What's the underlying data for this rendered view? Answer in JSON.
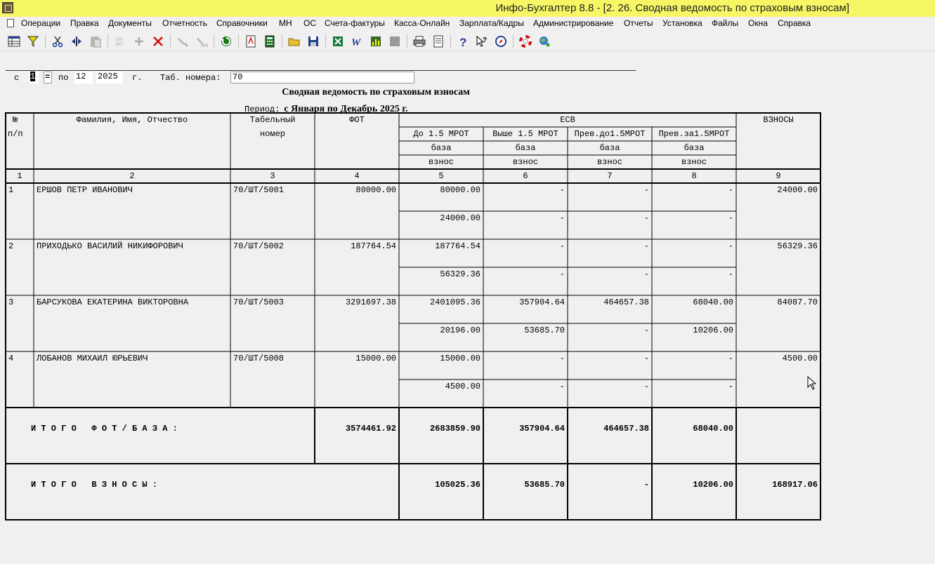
{
  "window": {
    "title": "Инфо-Бухгалтер 8.8 - [2. 26. Сводная ведомость по страховым взносам]"
  },
  "menu": [
    "Операции",
    "Правка",
    "Документы",
    "Отчетность",
    "Справочники",
    "МН",
    "ОС",
    "Счета-фактуры",
    "Касса-Онлайн",
    "Зарплата/Кадры",
    "Администрирование",
    "Отчеты",
    "Установка",
    "Файлы",
    "Окна",
    "Справка"
  ],
  "toolbar_icons": [
    "table-icon",
    "filter-icon",
    "cut-icon",
    "split-icon",
    "paste-icon",
    "rotate-icon",
    "add-icon",
    "delete-icon",
    "marker-icon",
    "marker2-icon",
    "refresh-icon",
    "pdf-icon",
    "calculator-icon",
    "open-folder-icon",
    "save-icon",
    "excel-icon",
    "word-icon",
    "chart-icon",
    "gray-icon",
    "print-icon",
    "preview-icon",
    "help-icon",
    "context-help-icon",
    "compass-icon",
    "lifebuoy-icon",
    "globe-icon"
  ],
  "params": {
    "from_label": "с",
    "from_value": "1",
    "to_label": "по",
    "to_value": "12",
    "year_value": "2025",
    "year_label": "г.",
    "tab_label": "Таб. номера:",
    "tab_value": "70"
  },
  "report": {
    "title": "Сводная ведомость по страховым взносам",
    "period_label": "Период:",
    "period_value": "с Января по Декабрь 2025 г.",
    "headers": {
      "num1": "№",
      "num2": "п/п",
      "fio": "Фамилия, Имя, Отчество",
      "tab1": "Табельный",
      "tab2": "номер",
      "fot": "ФОТ",
      "esv": "ЕСВ",
      "sub": [
        "До 1.5 МРОТ",
        "Выше 1.5 МРОТ",
        "Прев.до1.5МРОТ",
        "Прев.за1.5МРОТ"
      ],
      "baza": "база",
      "vznos": "взнос",
      "vznosy": "ВЗНОСЫ",
      "col_numbers": [
        "1",
        "2",
        "3",
        "4",
        "5",
        "6",
        "7",
        "8",
        "9"
      ]
    },
    "rows": [
      {
        "n": "1",
        "name": "ЕРШОВ ПЕТР ИВАНОВИЧ",
        "tab": "70/ШТ/5001",
        "fot": "80000.00",
        "base": [
          "80000.00",
          "-",
          "-",
          "-"
        ],
        "contrib": [
          "24000.00",
          "-",
          "-",
          "-"
        ],
        "total": "24000.00"
      },
      {
        "n": "2",
        "name": "ПРИХОДЬКО ВАСИЛИЙ НИКИФОРОВИЧ",
        "tab": "70/ШТ/5002",
        "fot": "187764.54",
        "base": [
          "187764.54",
          "-",
          "-",
          "-"
        ],
        "contrib": [
          "56329.36",
          "-",
          "-",
          "-"
        ],
        "total": "56329.36"
      },
      {
        "n": "3",
        "name": "БАРСУКОВА ЕКАТЕРИНА ВИКТОРОВНА",
        "tab": "70/ШТ/5003",
        "fot": "3291697.38",
        "base": [
          "2401095.36",
          "357904.64",
          "464657.38",
          "68040.00"
        ],
        "contrib": [
          "20196.00",
          "53685.70",
          "-",
          "10206.00"
        ],
        "total": "84087.70"
      },
      {
        "n": "4",
        "name": "ЛОБАНОВ МИХАИЛ ЮРЬЕВИЧ",
        "tab": "70/ШТ/5008",
        "fot": "15000.00",
        "base": [
          "15000.00",
          "-",
          "-",
          "-"
        ],
        "contrib": [
          "4500.00",
          "-",
          "-",
          "-"
        ],
        "total": "4500.00"
      }
    ],
    "totals_base": {
      "label": "И Т О Г О   Ф О Т / Б А З А :",
      "fot": "3574461.92",
      "values": [
        "2683859.90",
        "357904.64",
        "464657.38",
        "68040.00"
      ],
      "total": ""
    },
    "totals_contrib": {
      "label": "И Т О Г О   В З Н О С Ы :",
      "values": [
        "105025.36",
        "53685.70",
        "-",
        "10206.00"
      ],
      "total": "168917.06"
    }
  }
}
